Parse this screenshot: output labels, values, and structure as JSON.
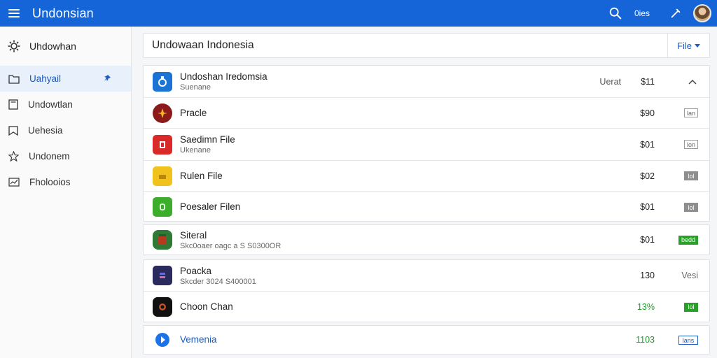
{
  "header": {
    "title": "Undonsian",
    "status_text": "0ies"
  },
  "sidebar": {
    "header_label": "Uhdowhan",
    "items": [
      {
        "label": "Uahyail",
        "active": true
      },
      {
        "label": "Undowtlan"
      },
      {
        "label": "Uehesia"
      },
      {
        "label": "Undonem"
      },
      {
        "label": "Fholooios"
      }
    ]
  },
  "main": {
    "title": "Undowaan Indonesia",
    "file_button_label": "File"
  },
  "group1": {
    "rows": [
      {
        "name": "Undoshan Iredomsia",
        "sub": "Suenane",
        "extra": "Uerat",
        "value": "$11"
      },
      {
        "name": "Pracle",
        "value": "$90",
        "action": "lan"
      },
      {
        "name": "Saedimn File",
        "sub": "Ukenane",
        "value": "$01",
        "action": "lon"
      },
      {
        "name": "Rulen File",
        "value": "$02",
        "action": "lol"
      },
      {
        "name": "Poesaler Filen",
        "value": "$01",
        "action": "lol"
      }
    ]
  },
  "group2": {
    "rows": [
      {
        "name": "Siteral",
        "sub": "Skc0oaer oagc a S S0300OR",
        "value": "$01",
        "action": "bedd"
      }
    ]
  },
  "group3": {
    "rows": [
      {
        "name": "Poacka",
        "sub": "Skcder 3024 S400001",
        "value": "130",
        "action": "Vesi"
      },
      {
        "name": "Choon Chan",
        "value": "13%",
        "action": "lol"
      }
    ]
  },
  "group4": {
    "rows": [
      {
        "name": "Vemenia",
        "value": "1103",
        "action": "lans"
      }
    ]
  }
}
